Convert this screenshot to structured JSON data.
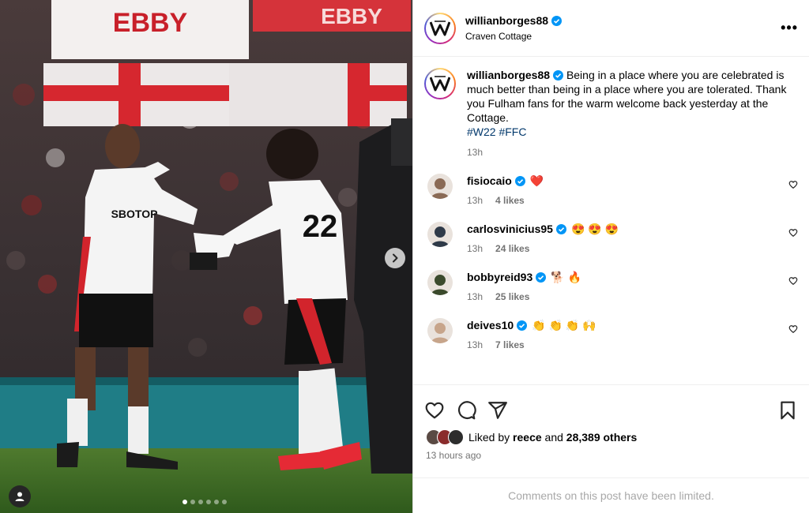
{
  "post": {
    "author": "willianborges88",
    "location": "Craven Cottage",
    "caption": "Being in a place where you are celebrated is much better than being in a place where you are tolerated. Thank you Fulham fans for the warm welcome back yesterday at the Cottage.",
    "hashtags": [
      "#W22",
      "#FFC"
    ],
    "time": "13h",
    "more_label": "•••"
  },
  "media": {
    "banner_text_1": "EBBY",
    "banner_text_2": "EBBY",
    "sponsor": "SBOTOP",
    "shirt_number": "22",
    "carousel_count": 6,
    "carousel_active": 0
  },
  "comments": [
    {
      "user": "fisiocaio",
      "verified": true,
      "text": "❤️",
      "time": "13h",
      "likes": "4 likes",
      "avatar_color": "#8a6a55"
    },
    {
      "user": "carlosvinicius95",
      "verified": true,
      "text": "😍 😍 😍",
      "time": "13h",
      "likes": "24 likes",
      "avatar_color": "#2f3a48"
    },
    {
      "user": "bobbyreid93",
      "verified": true,
      "text": "🐕 🔥",
      "time": "13h",
      "likes": "25 likes",
      "avatar_color": "#3b4a2c"
    },
    {
      "user": "deives10",
      "verified": true,
      "text": "👏 👏 👏 🙌",
      "time": "13h",
      "likes": "7 likes",
      "avatar_color": "#c7a58b"
    }
  ],
  "likes": {
    "prefix": "Liked by",
    "first_user": "reece",
    "connector": "and",
    "others": "28,389 others"
  },
  "posted_ago": "13 hours ago",
  "comments_limited": "Comments on this post have been limited.",
  "colors": {
    "verified": "#0095f6",
    "link": "#00376b",
    "muted": "#737373",
    "heart": "#ff3040"
  }
}
